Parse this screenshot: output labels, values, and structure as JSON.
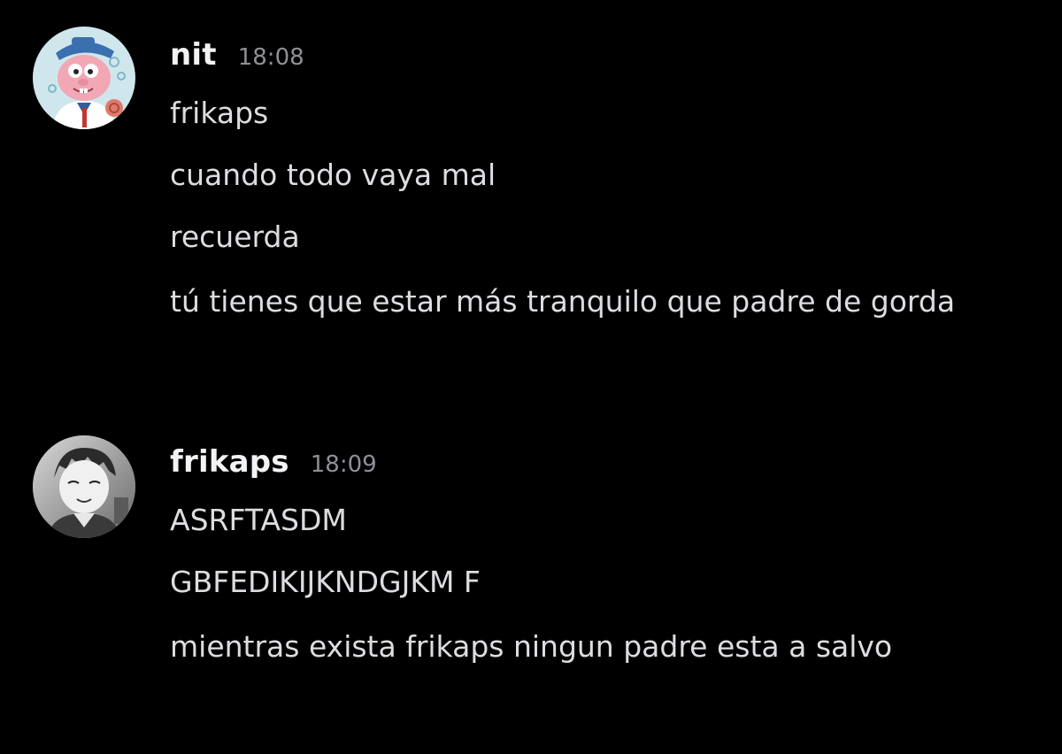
{
  "messages": [
    {
      "author": "nit",
      "timestamp": "18:08",
      "avatar_icon": "cartoon-sailor-avatar",
      "lines": [
        "frikaps",
        "cuando todo vaya mal",
        "recuerda",
        "tú tienes que estar más tranquilo que padre de gorda"
      ]
    },
    {
      "author": "frikaps",
      "timestamp": "18:09",
      "avatar_icon": "grayscale-anime-avatar",
      "lines": [
        "ASRFTASDM",
        "GBFEDIKIJKNDGJKM F",
        "mientras exista frikaps ningun padre esta a salvo"
      ]
    }
  ],
  "colors": {
    "background": "#000000",
    "username": "#f2f3f5",
    "message_text": "#dcdde0",
    "timestamp": "#8e9096"
  }
}
